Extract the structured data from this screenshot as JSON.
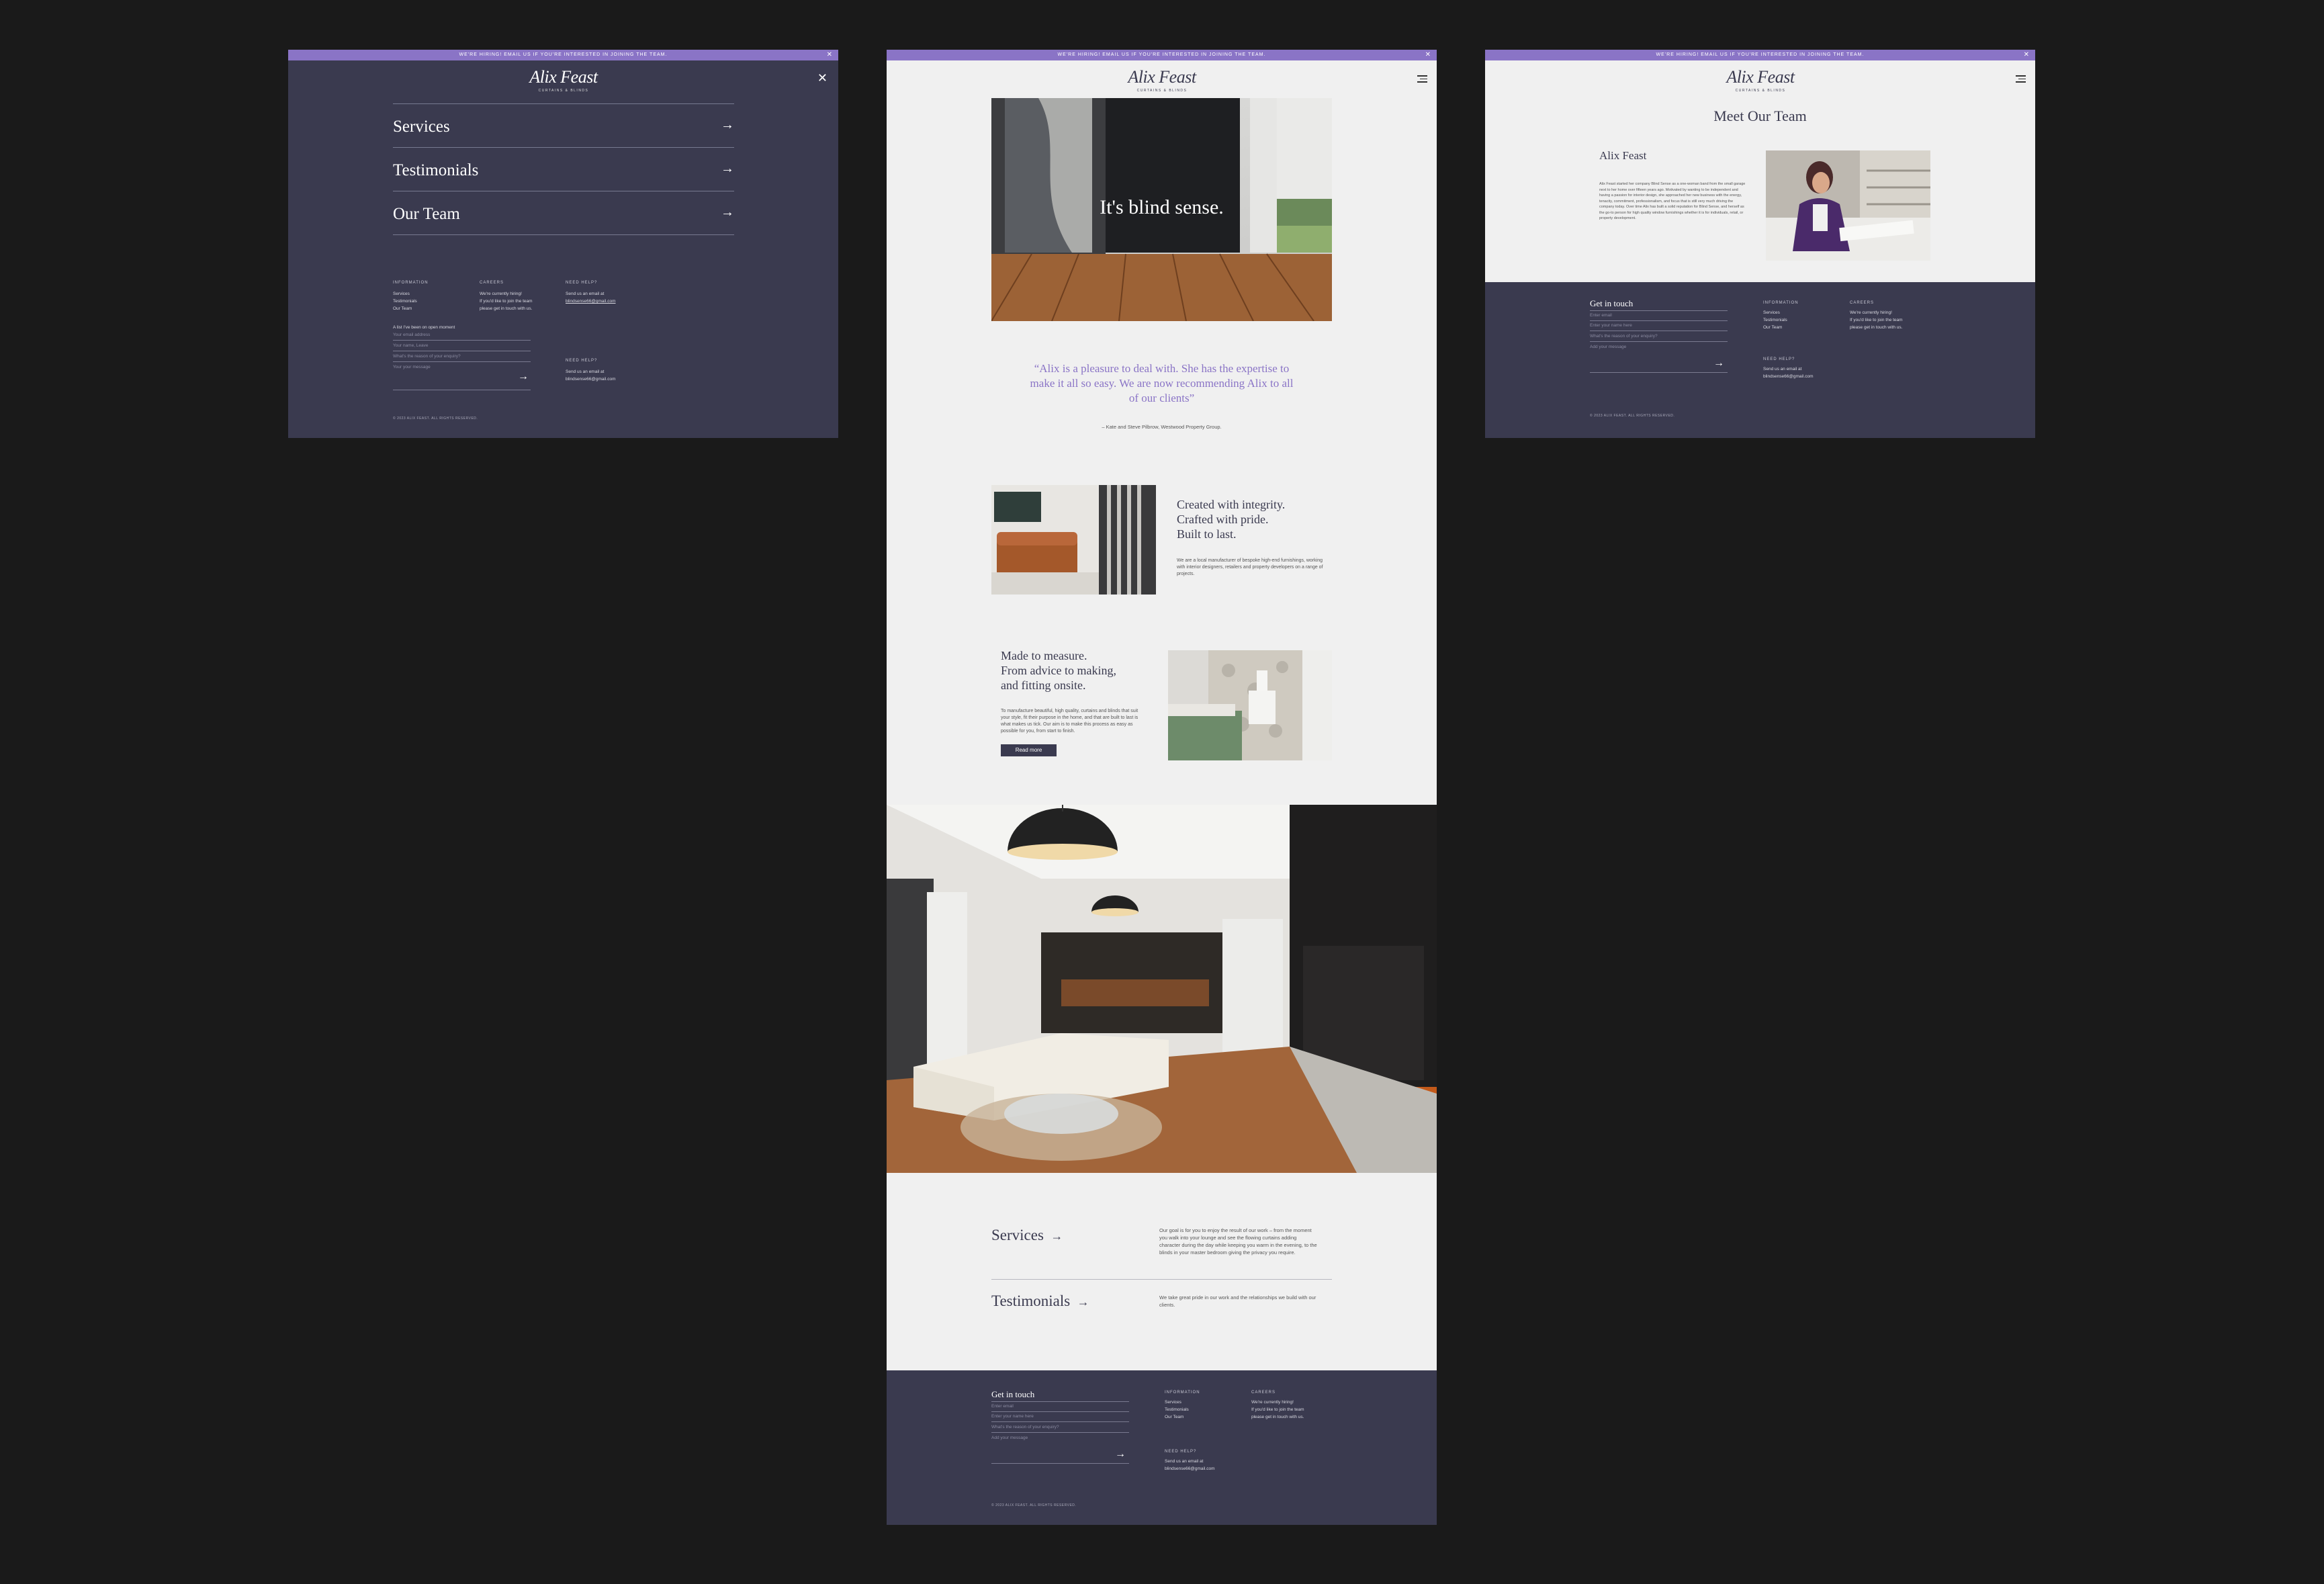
{
  "banner": {
    "text": "We're hiring! Email us if you're interested in joining the team.",
    "close": "✕"
  },
  "logo": {
    "name": "Alix Feast",
    "sub": "Curtains & Blinds"
  },
  "menu": {
    "items": [
      {
        "label": "Services",
        "arrow": "→"
      },
      {
        "label": "Testimonials",
        "arrow": "→"
      },
      {
        "label": "Our Team",
        "arrow": "→"
      }
    ],
    "close": "✕"
  },
  "footer": {
    "get_in_touch": "Get in touch",
    "info_label": "Information",
    "info_links": [
      "Services",
      "Testimonials",
      "Our Team"
    ],
    "careers_label": "Careers",
    "careers_text": [
      "We're currently hiring!",
      "If you'd like to join the team",
      "please get in touch with us."
    ],
    "help_label": "Need help?",
    "help_text": "Send us an email at",
    "email": "blindsense66@gmail.com",
    "email_short": "blindsense66@gmail.com",
    "prompt": "A list I've been on open moment",
    "fields": [
      "Your email address",
      "Your name, Leave",
      "What's the reason of your enquiry?",
      "Your your message"
    ],
    "fields_main": [
      "Enter email",
      "Enter your name here",
      "What's the reason of your enquiry?",
      "Add your message"
    ],
    "copyright": "© 2023 ALIX FEAST. ALL RIGHTS RESERVED."
  },
  "hero": {
    "text": "It's blind sense."
  },
  "quote": {
    "text": "“Alix is a pleasure to deal with. She has the expertise to make it all so easy. We are now recommending Alix to all of our clients”",
    "author": "– Kate and Steve Pilbrow, Westwood Property Group."
  },
  "feature1": {
    "heading": [
      "Created with integrity.",
      "Crafted with pride.",
      "Built to last."
    ],
    "body": "We are a local manufacturer of bespoke high-end furnishings, working with interior designers, retailers and property developers on a range of projects."
  },
  "feature2": {
    "heading": [
      "Made to measure.",
      "From advice to making,",
      "and fitting onsite."
    ],
    "body": "To manufacture beautiful, high quality, curtains and blinds that suit your style, fit their purpose in the home, and that are built to last is what makes us tick. Our aim is to make this process as easy as possible for you, from start to finish.",
    "button": "Read more"
  },
  "links": [
    {
      "label": "Services",
      "arrow": "→",
      "text": "Our goal is for you to enjoy the result of our work – from the moment you walk into your lounge and see the flowing curtains adding character during the day while keeping you warm in the evening, to the blinds in your master bedroom giving the privacy you require."
    },
    {
      "label": "Testimonials",
      "arrow": "→",
      "text": "We take great pride in our work and the relationships we build with our clients."
    }
  ],
  "team": {
    "title": "Meet Our Team",
    "name": "Alix Feast",
    "bio": "Alix Feast started her company Blind Sense as a one-woman band from the small garage next to her home over fifteen years ago. Motivated by wanting to be independent and having a passion for interior design, she approached her new business with the energy, tenacity, commitment, professionalism, and focus that is still very much driving the company today. Over time Alix has built a solid reputation for Blind Sense, and herself as the go-to person for high quality window furnishings whether it is for individuals, retail, or property development."
  },
  "colors": {
    "accent": "#8a74c6",
    "dark": "#3a3a4f",
    "page": "#f0f0f0",
    "backdrop": "#1a1a1a"
  }
}
